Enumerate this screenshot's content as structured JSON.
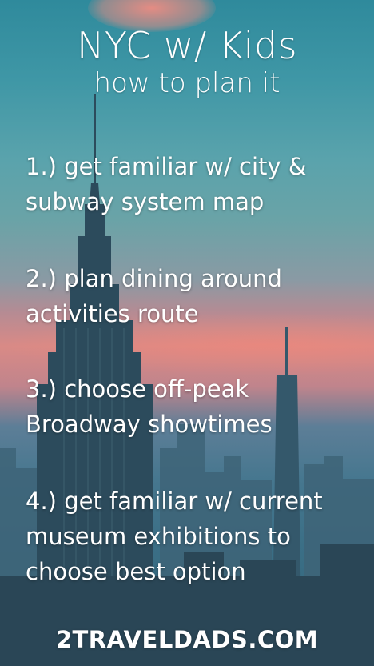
{
  "poster": {
    "title": "NYC w/ Kids",
    "subtitle": "how to plan it",
    "tips": [
      {
        "line1": "1.) get familiar w/ city &",
        "line2": "subway system map"
      },
      {
        "line1": "2.) plan dining around",
        "line2": "activities route"
      },
      {
        "line1": "3.) choose off-peak",
        "line2": "Broadway showtimes"
      },
      {
        "line1": "4.) get familiar w/ current",
        "line2": "museum exhibitions to",
        "line3": "choose best option"
      }
    ],
    "footer": "2TRAVELDADS.COM"
  },
  "colors": {
    "sky_top": "#2f8a9c",
    "sunset_pink": "#d98a86",
    "buildings": "#2c4b5c",
    "text": "#ffffff"
  }
}
